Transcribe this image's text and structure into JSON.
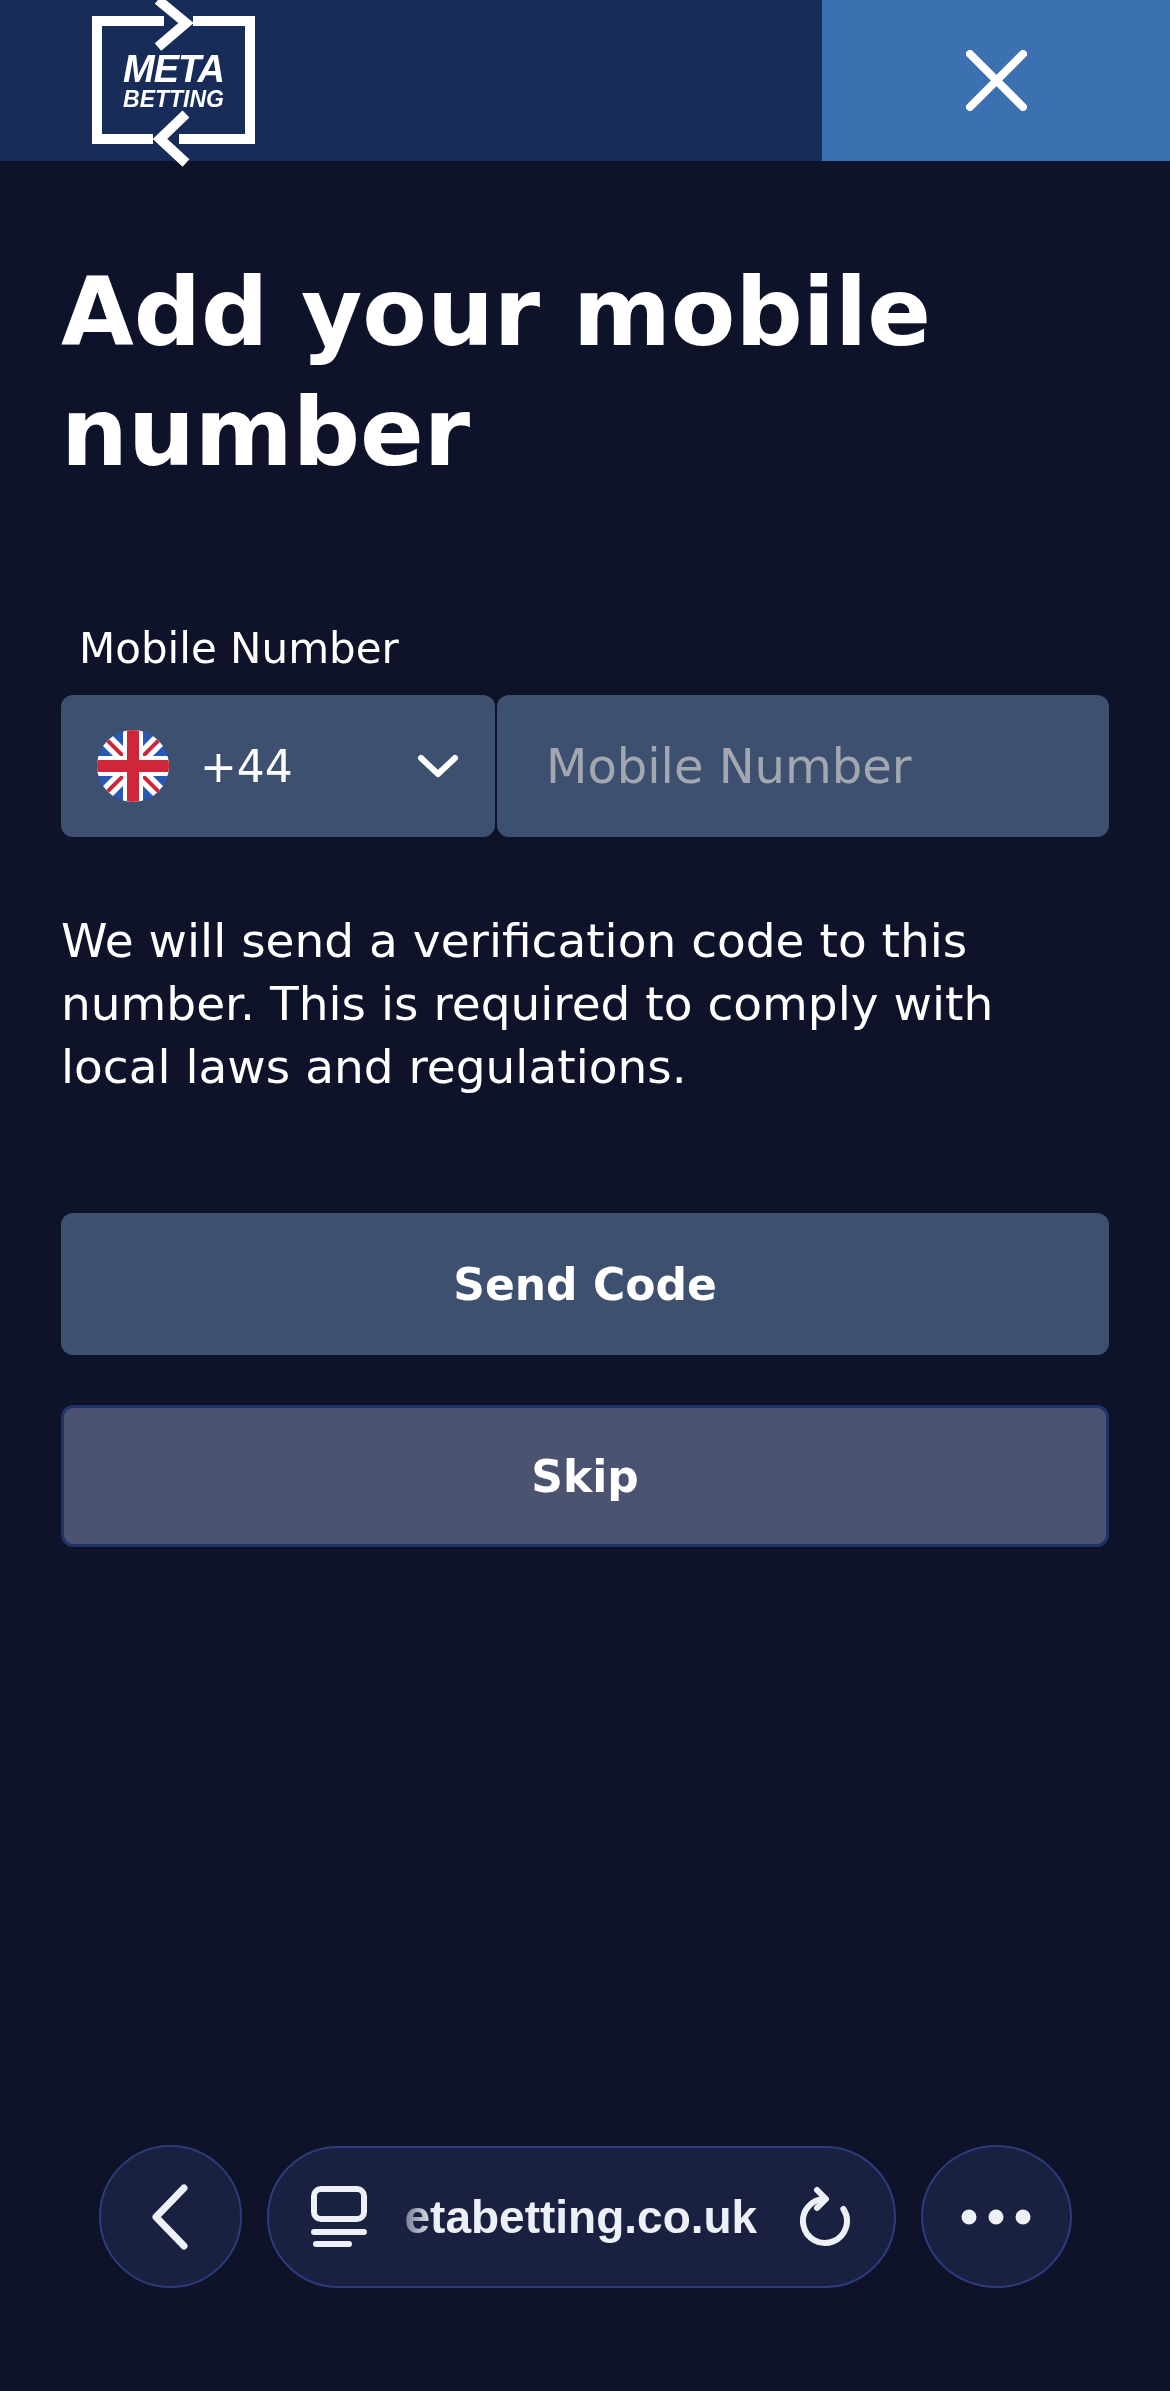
{
  "header": {
    "logo": {
      "lines": [
        "META",
        "BETTING"
      ]
    }
  },
  "title": "Add your mobile number",
  "phone_field": {
    "label": "Mobile Number",
    "country_code": "+44",
    "placeholder": "Mobile Number"
  },
  "notice": "We will send a verification code to this number. This is required to comply with local laws and regulations.",
  "buttons": [
    {
      "label": "Send Code",
      "kind": "primary"
    },
    {
      "label": "Skip",
      "kind": "secondary"
    }
  ],
  "browser_bar": {
    "url": "etabetting.co.uk"
  }
}
